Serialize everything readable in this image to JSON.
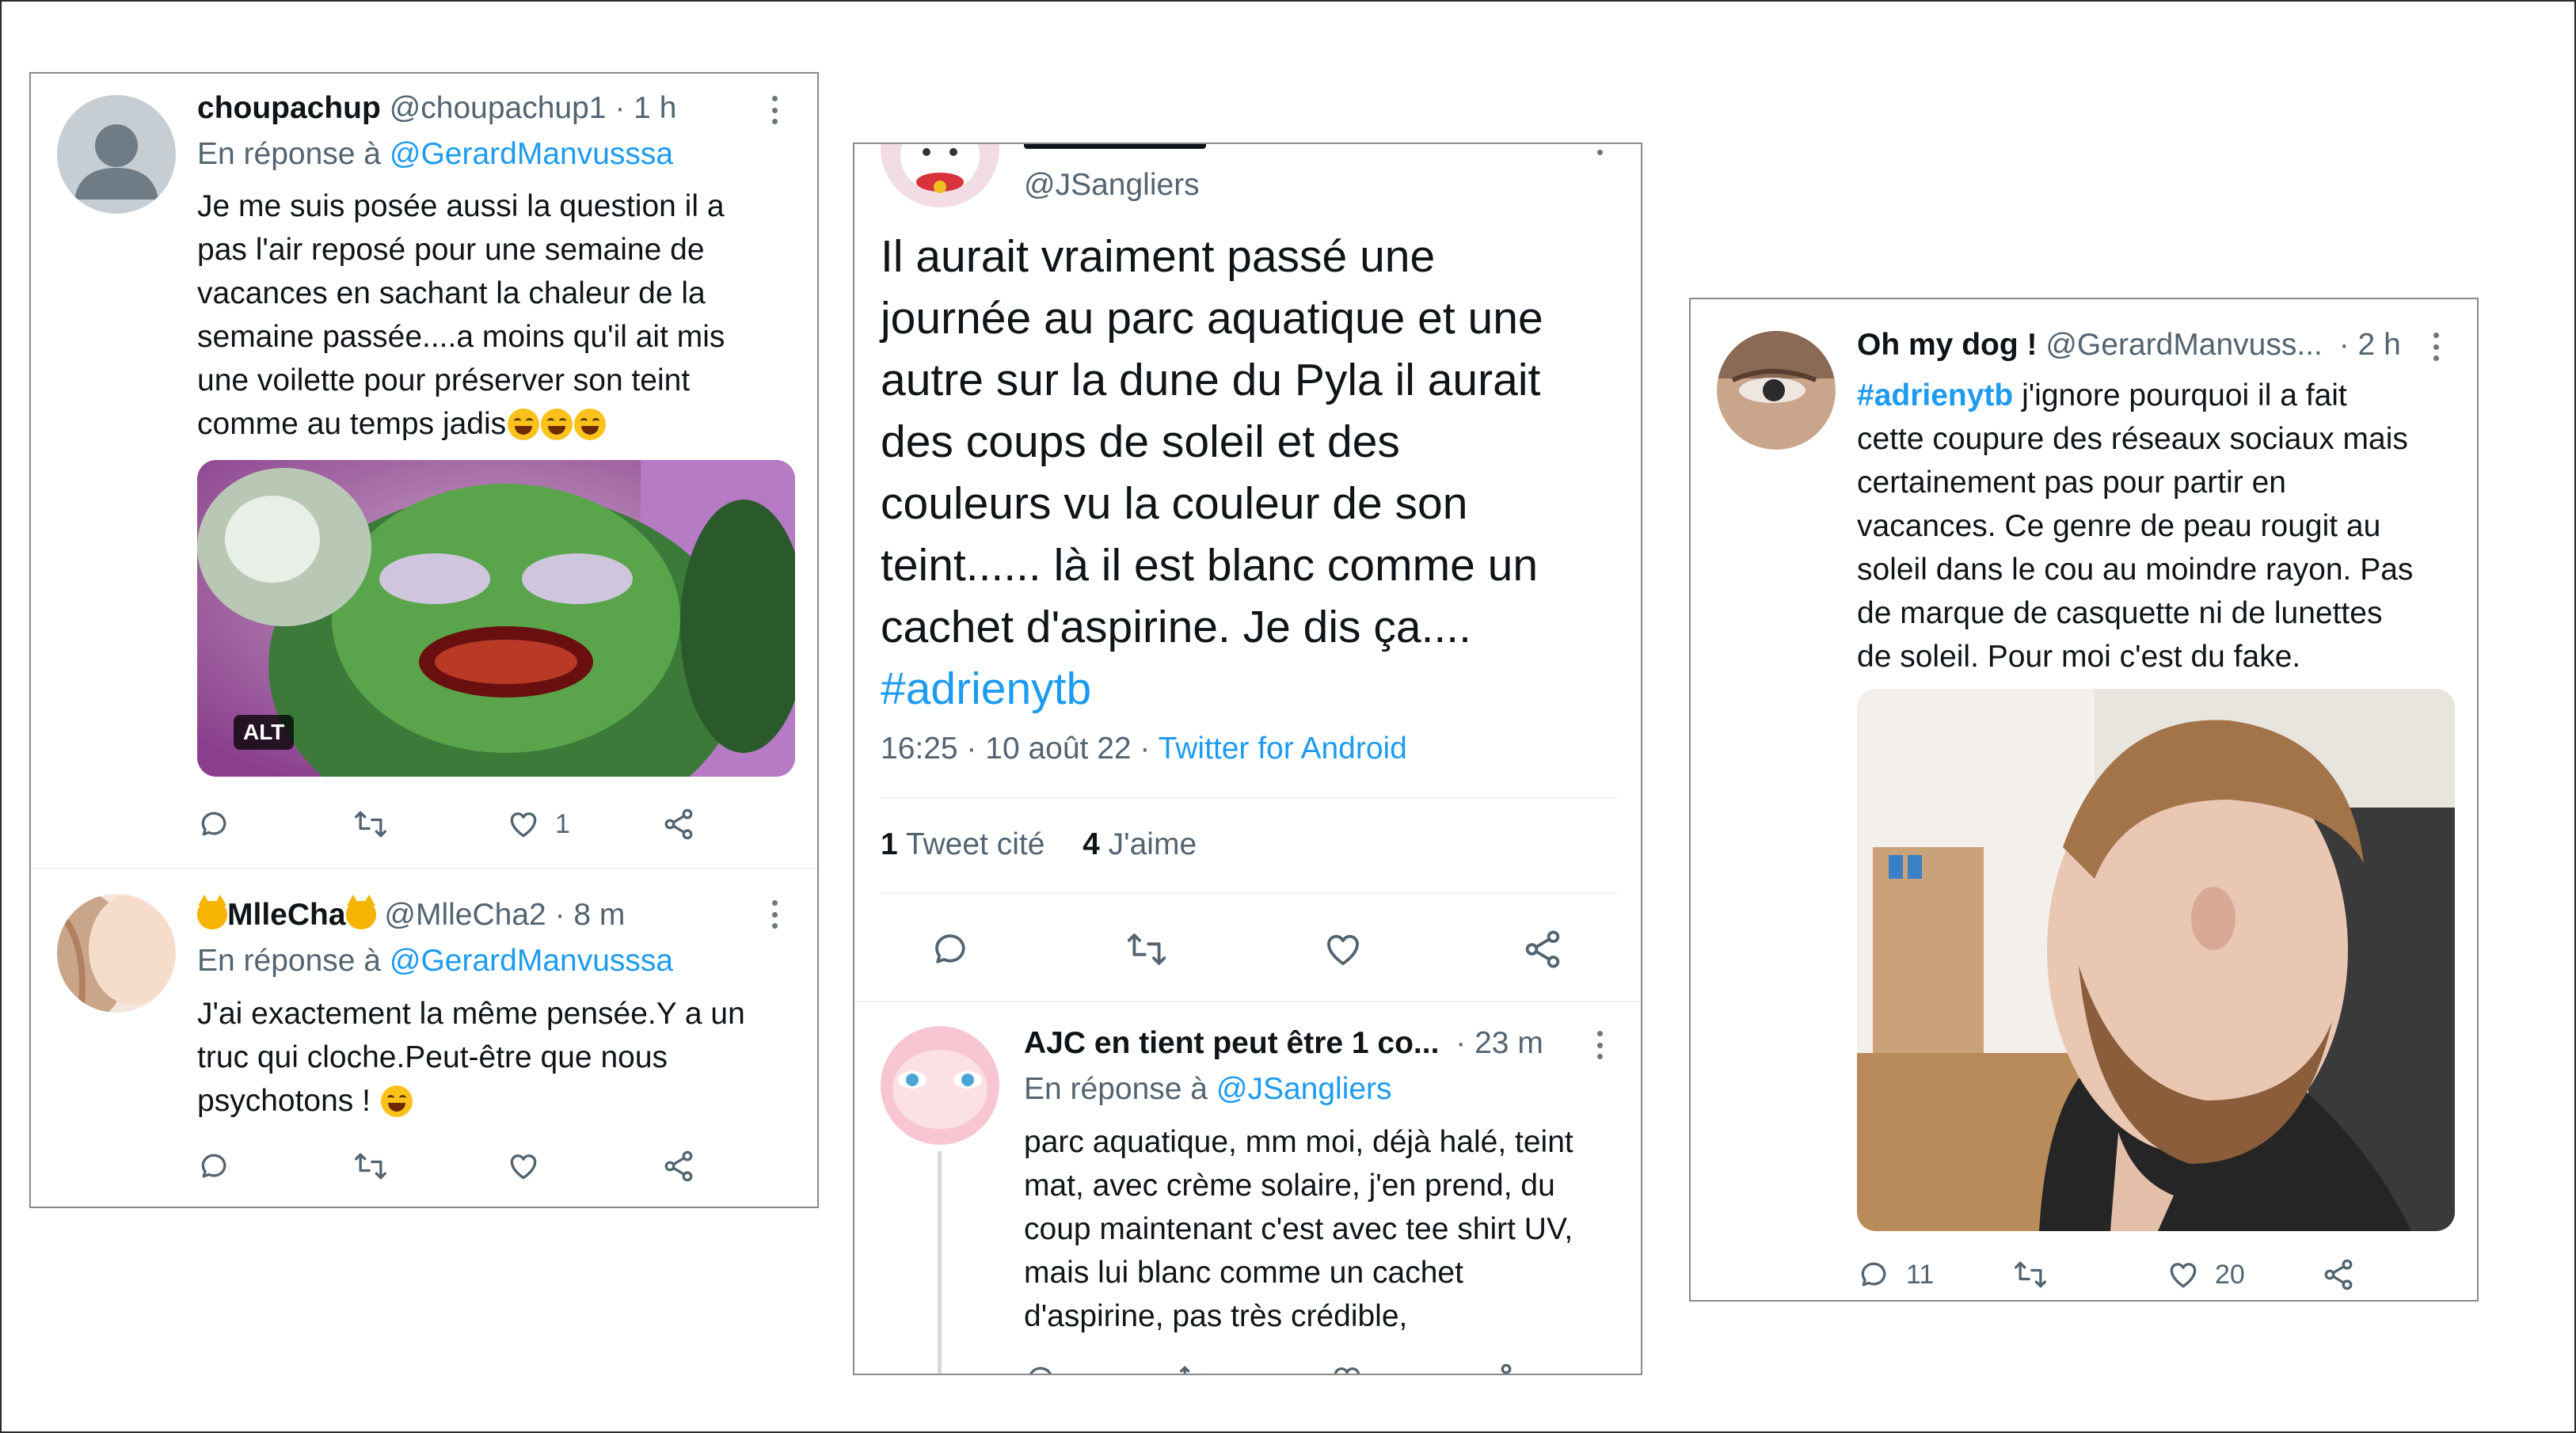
{
  "left": {
    "tweet1": {
      "name": "choupachup",
      "handle": "@choupachup1",
      "time": "· 1 h",
      "reply_prefix": "En réponse à",
      "reply_to": "@GerardManvusssa",
      "text_lines": [
        "Je me suis posée aussi la question il a",
        "pas l'air reposé pour une semaine de",
        "vacances en sachant la chaleur de la",
        "semaine passée....a moins qu'il ait mis",
        "une voilette pour préserver son teint",
        "comme au temps jadis"
      ],
      "alt_badge": "ALT",
      "like_count": "1"
    },
    "tweet2": {
      "name": "MlleCha",
      "handle": "@MlleCha2",
      "time": "· 8 m",
      "reply_prefix": "En réponse à",
      "reply_to": "@GerardManvusssa",
      "text_lines": [
        "J'ai exactement la même pensée.Y a un",
        "truc qui cloche.Peut-être que nous",
        "psychotons !"
      ]
    }
  },
  "middle": {
    "main": {
      "handle": "@JSangliers",
      "text_lines": [
        "Il aurait vraiment passé une",
        "journée au parc aquatique et une",
        "autre sur la dune du Pyla il aurait",
        "des coups de soleil et des",
        "couleurs vu la couleur de son",
        "teint...... là il est blanc comme un",
        "cachet d'aspirine. Je dis ça....",
        "#adrienytb"
      ],
      "meta_time": "16:25 · 10 août 22 ·",
      "meta_source": "Twitter for Android",
      "quote_count": "1",
      "quote_label": "Tweet cité",
      "like_count": "4",
      "like_label": "J'aime"
    },
    "reply": {
      "name": "AJC en tient peut être 1 co...",
      "time": "· 23 m",
      "reply_prefix": "En réponse à",
      "reply_to": "@JSangliers",
      "text_lines": [
        "parc aquatique, mm moi, déjà halé, teint",
        "mat, avec crème solaire, j'en prend, du",
        "coup maintenant c'est avec tee shirt UV,",
        "mais lui blanc comme un cachet",
        "d'aspirine, pas très crédible,"
      ]
    }
  },
  "right": {
    "tweet": {
      "name": "Oh my dog !",
      "handle": "@GerardManvuss...",
      "time": "· 2 h",
      "hashtag": "#adrienytb",
      "text_first": " j'ignore pourquoi il a fait",
      "text_lines": [
        "cette coupure des réseaux sociaux mais",
        "certainement pas pour partir en",
        "vacances. Ce genre de peau rougit au",
        "soleil dans le cou au moindre rayon. Pas",
        "de marque de casquette ni de lunettes",
        "de soleil. Pour moi c'est du fake."
      ],
      "reply_count": "11",
      "like_count": "20"
    }
  },
  "colors": {
    "link": "#1d9bf0",
    "muted": "#536471",
    "text": "#0f1419"
  },
  "icons": [
    "reply-icon",
    "retweet-icon",
    "like-icon",
    "share-icon",
    "more-icon"
  ]
}
